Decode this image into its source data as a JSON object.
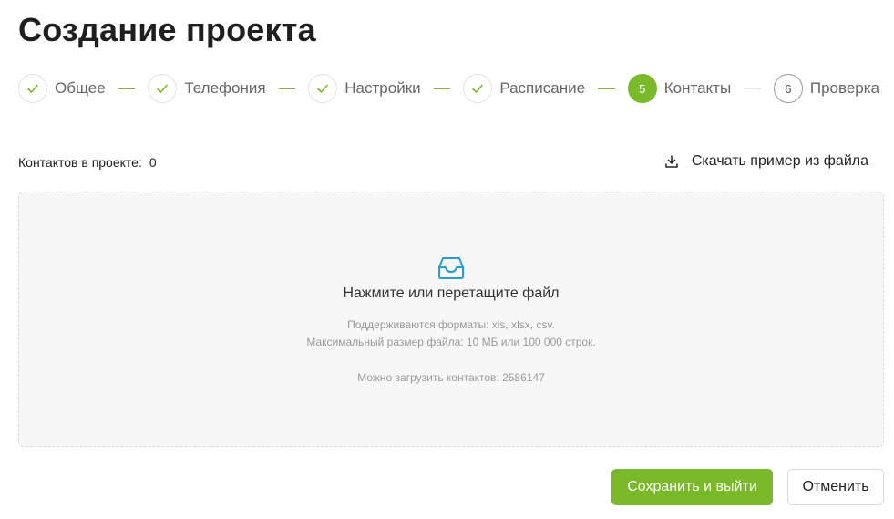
{
  "title": "Создание проекта",
  "accent_color": "#7ab929",
  "steps": [
    {
      "label": "Общее",
      "state": "done",
      "icon": "check-icon"
    },
    {
      "label": "Телефония",
      "state": "done",
      "icon": "check-icon"
    },
    {
      "label": "Настройки",
      "state": "done",
      "icon": "check-icon"
    },
    {
      "label": "Расписание",
      "state": "done",
      "icon": "check-icon"
    },
    {
      "label": "Контакты",
      "state": "active",
      "number": "5"
    },
    {
      "label": "Проверка",
      "state": "pending",
      "number": "6"
    }
  ],
  "contacts": {
    "label": "Контактов в проекте:",
    "count": "0"
  },
  "download": {
    "label": "Скачать пример из файла",
    "icon": "download-icon"
  },
  "dropzone": {
    "icon": "inbox-icon",
    "main": "Нажмите или перетащите файл",
    "formats": "Поддерживаются форматы: xls, xlsx, csv.",
    "max_size": "Максимальный размер файла: 10 МБ или 100 000 строк.",
    "limit": "Можно загрузить контактов: 2586147"
  },
  "buttons": {
    "save": "Сохранить и выйти",
    "cancel": "Отменить"
  }
}
